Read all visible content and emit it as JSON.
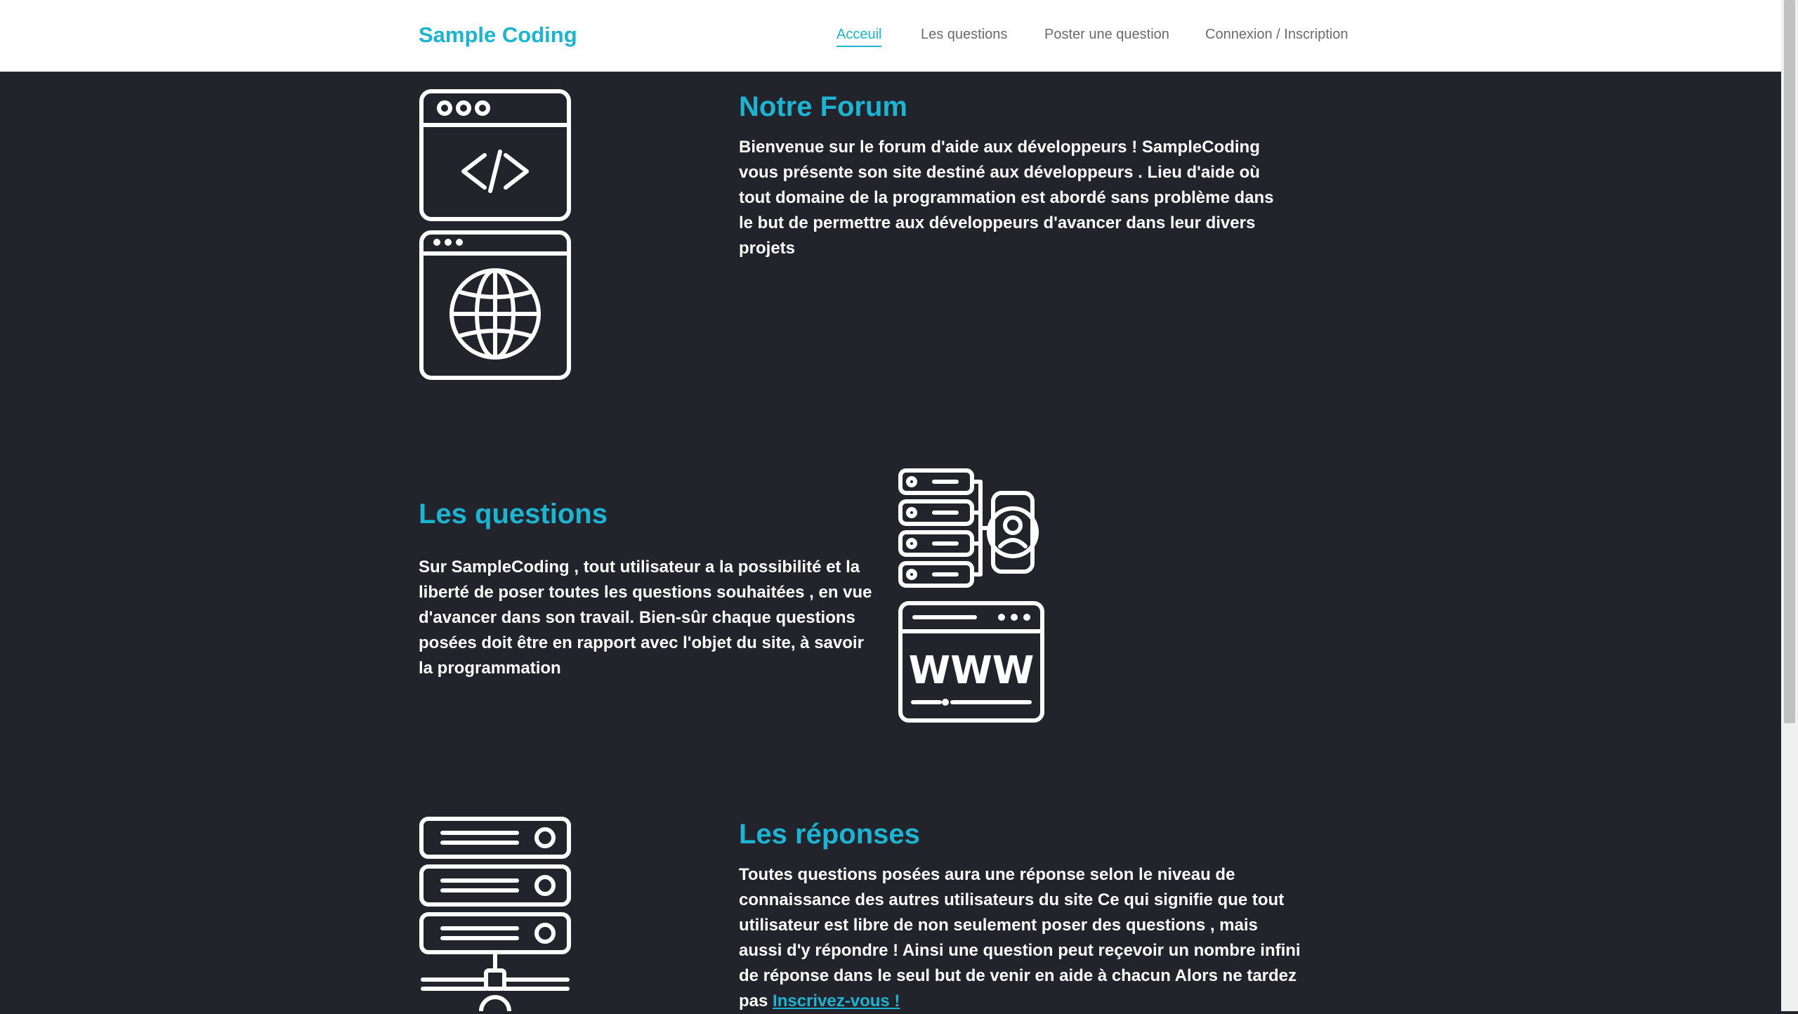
{
  "navbar": {
    "brand": "Sample Coding",
    "links": [
      "Acceuil",
      "Les questions",
      "Poster une question",
      "Connexion / Inscription"
    ],
    "active_index": 0
  },
  "sections": {
    "forum": {
      "title": "Notre Forum",
      "text": "Bienvenue sur le forum d'aide aux développeurs ! SampleCoding vous présente son site destiné aux développeurs . Lieu d'aide où tout domaine de la programmation est abordé sans problème dans le but de permettre aux développeurs d'avancer dans leur divers projets",
      "icons": [
        "code-window-icon",
        "globe-window-icon"
      ]
    },
    "questions": {
      "title": "Les questions",
      "text": "Sur SampleCoding , tout utilisateur a la possibilité et la liberté de poser toutes les questions souhaitées , en vue d'avancer dans son travail. Bien-sûr chaque questions posées doit être en rapport avec l'objet du site, à savoir la programmation",
      "icons": [
        "server-user-icon",
        "www-window-icon"
      ]
    },
    "reponses": {
      "title": "Les réponses",
      "text": "Toutes questions posées aura une réponse selon le niveau de connaissance des autres utilisateurs du site Ce qui signifie que tout utilisateur est libre de non seulement poser des questions , mais aussi d'y répondre ! Ainsi une question peut reçevoir un nombre infini de réponse dans le seul but de venir en aide à chacun Alors ne tardez pas",
      "link": "Inscrivez-vous !",
      "icons": [
        "server-network-icon"
      ]
    }
  },
  "colors": {
    "accent": "#19b5d2",
    "background": "#22232b",
    "navbar": "#ffffff",
    "nav_text": "#6b6b6b",
    "body_text": "#ffffff"
  }
}
